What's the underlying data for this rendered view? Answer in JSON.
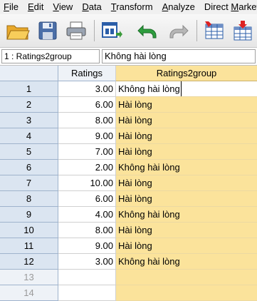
{
  "menu": [
    {
      "label": "File",
      "underline": "F"
    },
    {
      "label": "Edit",
      "underline": "E"
    },
    {
      "label": "View",
      "underline": "V"
    },
    {
      "label": "Data",
      "underline": "D"
    },
    {
      "label": "Transform",
      "underline": "T"
    },
    {
      "label": "Analyze",
      "underline": "A"
    },
    {
      "label": "Direct Marketing",
      "underline": "M"
    }
  ],
  "toolbar": {
    "icons": [
      "open-folder-icon",
      "save-icon",
      "print-icon",
      "recall-dialog-icon",
      "undo-icon",
      "redo-icon",
      "goto-case-icon",
      "goto-variable-icon"
    ]
  },
  "editor": {
    "cell_ref": "1 : Ratings2group",
    "cell_value": "Không hài lòng"
  },
  "columns": [
    "Ratings",
    "Ratings2group"
  ],
  "rows": [
    {
      "n": "1",
      "ratings": "3.00",
      "group": "Không hài lòng"
    },
    {
      "n": "2",
      "ratings": "6.00",
      "group": "Hài lòng"
    },
    {
      "n": "3",
      "ratings": "8.00",
      "group": "Hài lòng"
    },
    {
      "n": "4",
      "ratings": "9.00",
      "group": "Hài lòng"
    },
    {
      "n": "5",
      "ratings": "7.00",
      "group": "Hài lòng"
    },
    {
      "n": "6",
      "ratings": "2.00",
      "group": "Không hài lòng"
    },
    {
      "n": "7",
      "ratings": "10.00",
      "group": "Hài lòng"
    },
    {
      "n": "8",
      "ratings": "6.00",
      "group": "Hài lòng"
    },
    {
      "n": "9",
      "ratings": "4.00",
      "group": "Không hài lòng"
    },
    {
      "n": "10",
      "ratings": "8.00",
      "group": "Hài lòng"
    },
    {
      "n": "11",
      "ratings": "9.00",
      "group": "Hài lòng"
    },
    {
      "n": "12",
      "ratings": "3.00",
      "group": "Không hài lòng"
    }
  ],
  "empty_rows": [
    "13",
    "14"
  ]
}
